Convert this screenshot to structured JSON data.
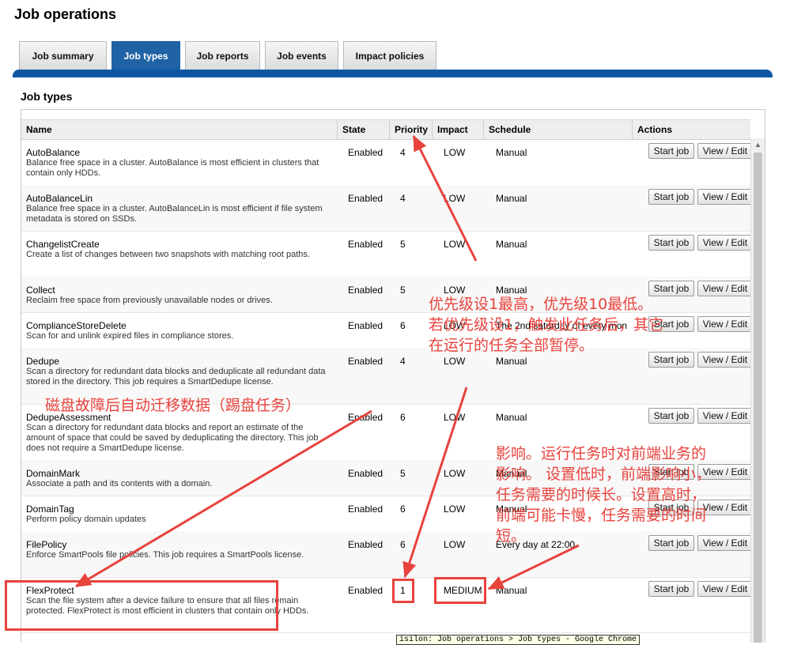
{
  "page": {
    "title": "Job operations",
    "section_title": "Job types"
  },
  "tabs": [
    {
      "label": "Job summary",
      "active": false
    },
    {
      "label": "Job types",
      "active": true
    },
    {
      "label": "Job reports",
      "active": false
    },
    {
      "label": "Job events",
      "active": false
    },
    {
      "label": "Impact policies",
      "active": false
    }
  ],
  "table": {
    "columns": {
      "name": "Name",
      "state": "State",
      "priority": "Priority",
      "impact": "Impact",
      "schedule": "Schedule",
      "actions": "Actions"
    },
    "start_label": "Start job",
    "view_label": "View / Edit",
    "rows": [
      {
        "name": "AutoBalance",
        "desc": "Balance free space in a cluster. AutoBalance is most efficient in clusters that contain only HDDs.",
        "state": "Enabled",
        "priority": "4",
        "impact": "LOW",
        "schedule": "Manual"
      },
      {
        "name": "AutoBalanceLin",
        "desc": "Balance free space in a cluster. AutoBalanceLin is most efficient if file system metadata is stored on SSDs.",
        "state": "Enabled",
        "priority": "4",
        "impact": "LOW",
        "schedule": "Manual"
      },
      {
        "name": "ChangelistCreate",
        "desc": "Create a list of changes between two snapshots with matching root paths.",
        "state": "Enabled",
        "priority": "5",
        "impact": "LOW",
        "schedule": "Manual"
      },
      {
        "name": "Collect",
        "desc": "Reclaim free space from previously unavailable nodes or drives.",
        "state": "Enabled",
        "priority": "5",
        "impact": "LOW",
        "schedule": "Manual"
      },
      {
        "name": "ComplianceStoreDelete",
        "desc": "Scan for and unlink expired files in compliance stores.",
        "state": "Enabled",
        "priority": "6",
        "impact": "LOW",
        "schedule": "The 2nd saturday of every mon"
      },
      {
        "name": "Dedupe",
        "desc": "Scan a directory for redundant data blocks and deduplicate all redundant data stored in the directory. This job requires a SmartDedupe license.",
        "state": "Enabled",
        "priority": "4",
        "impact": "LOW",
        "schedule": "Manual"
      },
      {
        "name": "DedupeAssessment",
        "desc": "Scan a directory for redundant data blocks and report an estimate of the amount of space that could be saved by deduplicating the directory. This job does not require a SmartDedupe license.",
        "state": "Enabled",
        "priority": "6",
        "impact": "LOW",
        "schedule": "Manual"
      },
      {
        "name": "DomainMark",
        "desc": "Associate a path and its contents with a domain.",
        "state": "Enabled",
        "priority": "5",
        "impact": "LOW",
        "schedule": "Manual"
      },
      {
        "name": "DomainTag",
        "desc": "Perform policy domain updates",
        "state": "Enabled",
        "priority": "6",
        "impact": "LOW",
        "schedule": "Manual"
      },
      {
        "name": "FilePolicy",
        "desc": "Enforce SmartPools file policies. This job requires a SmartPools license.",
        "state": "Enabled",
        "priority": "6",
        "impact": "LOW",
        "schedule": "Every day at 22:00"
      },
      {
        "name": "FlexProtect",
        "desc": "Scan the file system after a device failure to ensure that all files remain protected. FlexProtect is most efficient in clusters that contain only HDDs.",
        "state": "Enabled",
        "priority": "1",
        "impact": "MEDIUM",
        "schedule": "Manual"
      }
    ]
  },
  "tooltip": "isilon: Job operations > Job types - Google Chrome",
  "annotations": {
    "priority_note": [
      "优先级设1最高，优先级10最低。",
      "若优先级设1，触发此任务后，其它",
      "在运行的任务全部暂停。"
    ],
    "flexprotect_note": "磁盘故障后自动迁移数据（踢盘任务）",
    "impact_note": [
      "影响。运行任务时对前端业务的",
      "影响。 设置低时，前端影响小，",
      "任务需要的时候长。设置高时，",
      "前端可能卡慢，任务需要的时间",
      "短。"
    ],
    "color": "#e8433d"
  }
}
